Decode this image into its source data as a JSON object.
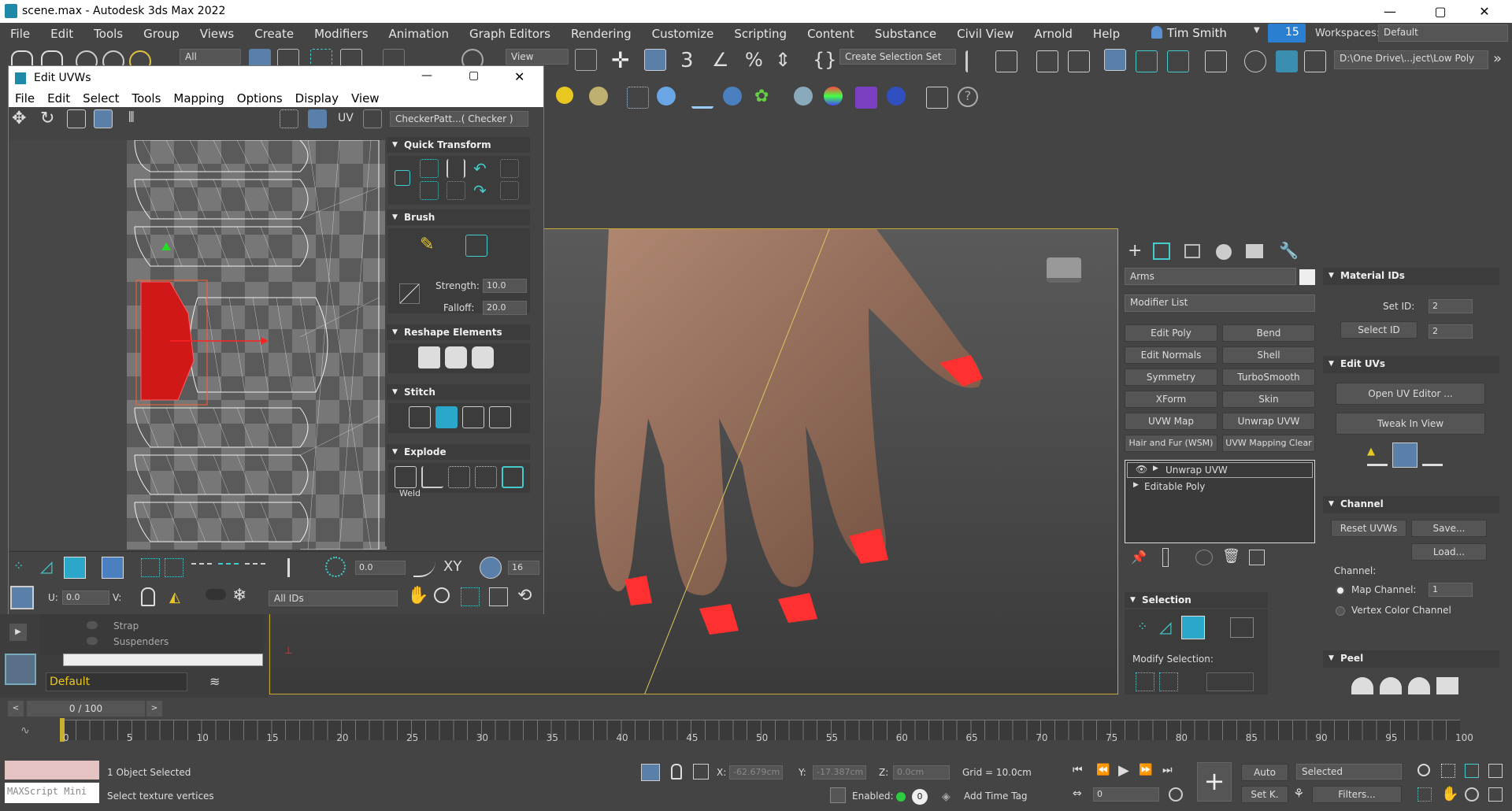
{
  "app": {
    "title": "scene.max - Autodesk 3ds Max 2022"
  },
  "menu": [
    "File",
    "Edit",
    "Tools",
    "Group",
    "Views",
    "Create",
    "Modifiers",
    "Animation",
    "Graph Editors",
    "Rendering",
    "Customize",
    "Scripting",
    "Content",
    "Substance",
    "Civil View",
    "Arnold",
    "Help"
  ],
  "user": {
    "name": "Tim Smith",
    "badge": "15",
    "workspaces_label": "Workspaces:",
    "workspace": "Default"
  },
  "toolbar": {
    "filter": "All",
    "view": "View",
    "selection_set": "Create Selection Set",
    "path": "D:\\One Drive\\...ject\\Low Poly"
  },
  "uv_editor": {
    "title": "Edit UVWs",
    "menu": [
      "File",
      "Edit",
      "Select",
      "Tools",
      "Mapping",
      "Options",
      "Display",
      "View"
    ],
    "uv_label": "UV",
    "checker": "CheckerPatt...( Checker )",
    "quick_transform": "Quick Transform",
    "brush": "Brush",
    "strength_label": "Strength:",
    "strength": "10.0",
    "falloff_label": "Falloff:",
    "falloff": "20.0",
    "reshape": "Reshape Elements",
    "stitch": "Stitch",
    "explode": "Explode",
    "weld": "Weld",
    "spin_value": "0.0",
    "xy": "XY",
    "grid_value": "16",
    "u_label": "U:",
    "u_value": "0.0",
    "v_label": "V:",
    "ids": "All IDs"
  },
  "scene_explorer": {
    "items": [
      "Strap",
      "Suspenders"
    ],
    "layer": "Default"
  },
  "command_panel": {
    "object_name": "Arms",
    "modifier_list": "Modifier List",
    "modifiers": [
      "Edit Poly",
      "Bend",
      "Edit Normals",
      "Shell",
      "Symmetry",
      "TurboSmooth",
      "XForm",
      "Skin",
      "UVW Map",
      "Unwrap UVW",
      "Hair and Fur (WSM)",
      "UVW Mapping Clear"
    ],
    "stack": [
      "Unwrap UVW",
      "Editable Poly"
    ],
    "selection": "Selection",
    "modify_selection": "Modify Selection:"
  },
  "uv_rollout": {
    "material_ids": "Material IDs",
    "set_id_label": "Set ID:",
    "set_id": "2",
    "select_id": "Select ID",
    "select_id_value": "2",
    "edit_uvs": "Edit UVs",
    "open_uv": "Open UV Editor ...",
    "tweak": "Tweak In View",
    "channel": "Channel",
    "reset": "Reset UVWs",
    "save": "Save...",
    "load": "Load...",
    "channel_label": "Channel:",
    "map_channel": "Map Channel:",
    "map_channel_value": "1",
    "vertex_color": "Vertex Color Channel",
    "peel": "Peel"
  },
  "timeline": {
    "frame": "0 / 100",
    "ticks": [
      "0",
      "5",
      "10",
      "15",
      "20",
      "25",
      "30",
      "35",
      "40",
      "45",
      "50",
      "55",
      "60",
      "65",
      "70",
      "75",
      "80",
      "85",
      "90",
      "95",
      "100"
    ]
  },
  "status": {
    "selected": "1 Object Selected",
    "prompt": "Select texture vertices",
    "maxscript": "MAXScript Mini",
    "x_label": "X:",
    "x": "-62.679cm",
    "y_label": "Y:",
    "y": "-17.387cm",
    "z_label": "Z:",
    "z": "0.0cm",
    "grid": "Grid = 10.0cm",
    "enabled": "Enabled:",
    "add_time_tag": "Add Time Tag",
    "auto": "Auto",
    "set_key": "Set K.",
    "selected_dd": "Selected",
    "filters": "Filters...",
    "frame_value": "0"
  }
}
